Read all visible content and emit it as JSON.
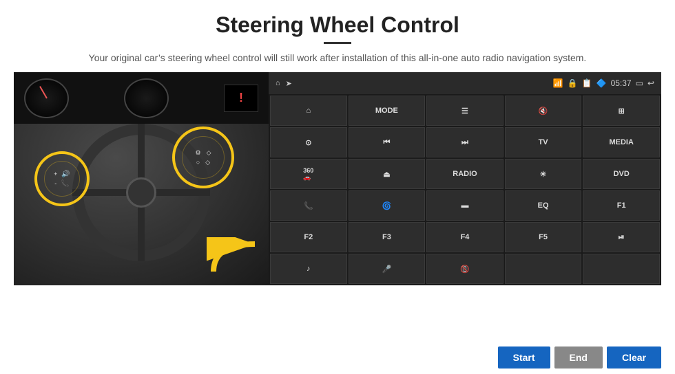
{
  "header": {
    "title": "Steering Wheel Control",
    "subtitle": "Your original car’s steering wheel control will still work after installation of this all-in-one auto radio navigation system.",
    "divider": true
  },
  "panel": {
    "status_bar": {
      "time": "05:37",
      "icons": [
        "wifi",
        "lock",
        "sim",
        "bluetooth",
        "monitor",
        "back"
      ]
    },
    "buttons": [
      {
        "id": "r1c1",
        "type": "icon",
        "icon": "home",
        "label": ""
      },
      {
        "id": "r1c2",
        "type": "text",
        "label": "MODE"
      },
      {
        "id": "r1c3",
        "type": "icon",
        "icon": "menu",
        "label": ""
      },
      {
        "id": "r1c4",
        "type": "icon",
        "icon": "mute",
        "label": ""
      },
      {
        "id": "r1c5",
        "type": "icon",
        "icon": "dots",
        "label": ""
      },
      {
        "id": "r2c1",
        "type": "icon",
        "icon": "settings-circle",
        "label": ""
      },
      {
        "id": "r2c2",
        "type": "icon",
        "icon": "prev",
        "label": ""
      },
      {
        "id": "r2c3",
        "type": "icon",
        "icon": "next",
        "label": ""
      },
      {
        "id": "r2c4",
        "type": "text",
        "label": "TV"
      },
      {
        "id": "r2c5",
        "type": "text",
        "label": "MEDIA"
      },
      {
        "id": "r3c1",
        "type": "icon",
        "icon": "360-car",
        "label": ""
      },
      {
        "id": "r3c2",
        "type": "icon",
        "icon": "eject",
        "label": ""
      },
      {
        "id": "r3c3",
        "type": "text",
        "label": "RADIO"
      },
      {
        "id": "r3c4",
        "type": "icon",
        "icon": "brightness",
        "label": ""
      },
      {
        "id": "r3c5",
        "type": "text",
        "label": "DVD"
      },
      {
        "id": "r4c1",
        "type": "icon",
        "icon": "phone",
        "label": ""
      },
      {
        "id": "r4c2",
        "type": "icon",
        "icon": "browse",
        "label": ""
      },
      {
        "id": "r4c3",
        "type": "icon",
        "icon": "screen",
        "label": ""
      },
      {
        "id": "r4c4",
        "type": "text",
        "label": "EQ"
      },
      {
        "id": "r4c5",
        "type": "text",
        "label": "F1"
      },
      {
        "id": "r5c1",
        "type": "text",
        "label": "F2"
      },
      {
        "id": "r5c2",
        "type": "text",
        "label": "F3"
      },
      {
        "id": "r5c3",
        "type": "text",
        "label": "F4"
      },
      {
        "id": "r5c4",
        "type": "text",
        "label": "F5"
      },
      {
        "id": "r5c5",
        "type": "icon",
        "icon": "play-pause",
        "label": ""
      },
      {
        "id": "r6c1",
        "type": "icon",
        "icon": "music",
        "label": ""
      },
      {
        "id": "r6c2",
        "type": "icon",
        "icon": "mic",
        "label": ""
      },
      {
        "id": "r6c3",
        "type": "icon",
        "icon": "call-end",
        "label": ""
      },
      {
        "id": "r6c4",
        "type": "empty",
        "label": ""
      },
      {
        "id": "r6c5",
        "type": "empty",
        "label": ""
      }
    ]
  },
  "bottom_controls": {
    "start_label": "Start",
    "end_label": "End",
    "clear_label": "Clear"
  }
}
